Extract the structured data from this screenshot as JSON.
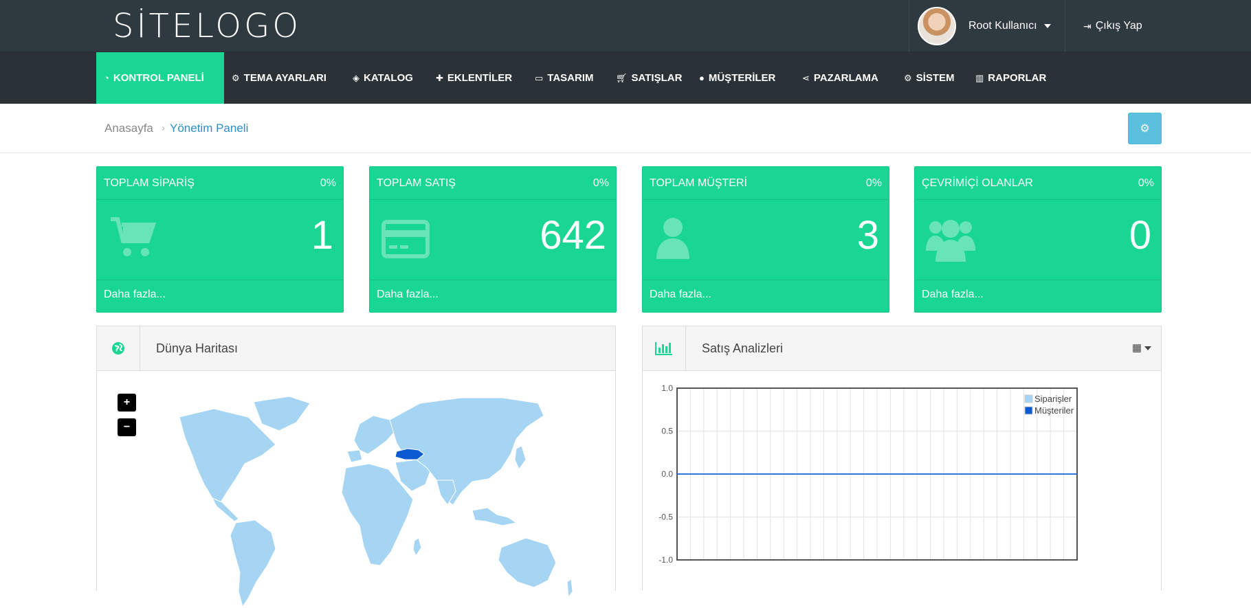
{
  "header": {
    "logo": "SİTELOGO",
    "user_name": "Root Kullanıcı",
    "logout_label": "Çıkış Yap"
  },
  "nav": {
    "items": [
      {
        "label": "KONTROL PANELİ",
        "icon": "dashboard-icon"
      },
      {
        "label": "TEMA AYARLARI",
        "icon": "cogs-icon"
      },
      {
        "label": "KATALOG",
        "icon": "tags-icon"
      },
      {
        "label": "EKLENTİLER",
        "icon": "puzzle-icon"
      },
      {
        "label": "TASARIM",
        "icon": "desktop-icon"
      },
      {
        "label": "SATIŞLAR",
        "icon": "cart-icon"
      },
      {
        "label": "MÜŞTERİLER",
        "icon": "user-icon"
      },
      {
        "label": "PAZARLAMA",
        "icon": "share-icon"
      },
      {
        "label": "SİSTEM",
        "icon": "gear-icon"
      },
      {
        "label": "RAPORLAR",
        "icon": "bar-chart-icon"
      }
    ]
  },
  "breadcrumb": {
    "home": "Anasayfa",
    "separator": "›",
    "current": "Yönetim Paneli"
  },
  "tiles": [
    {
      "title": "TOPLAM SİPARİŞ",
      "percent": "0%",
      "value": "1",
      "more": "Daha fazla...",
      "icon": "cart-icon"
    },
    {
      "title": "TOPLAM SATIŞ",
      "percent": "0%",
      "value": "642",
      "more": "Daha fazla...",
      "icon": "credit-card-icon"
    },
    {
      "title": "TOPLAM MÜŞTERİ",
      "percent": "0%",
      "value": "3",
      "more": "Daha fazla...",
      "icon": "user-icon"
    },
    {
      "title": "ÇEVRİMİÇİ OLANLAR",
      "percent": "0%",
      "value": "0",
      "more": "Daha fazla...",
      "icon": "users-icon"
    }
  ],
  "map_panel": {
    "title": "Dünya Haritası",
    "zoom_in": "+",
    "zoom_out": "−",
    "highlight_color": "#0a5bd1",
    "land_color": "#a5d5f2"
  },
  "chart_panel": {
    "title": "Satış Analizleri"
  },
  "colors": {
    "accent": "#19d693",
    "topbar": "#2f3940",
    "navbar": "#2a3238",
    "link": "#2a8fc8",
    "info_button": "#5bc0de"
  },
  "chart_data": {
    "type": "line",
    "series": [
      {
        "name": "Siparişler",
        "color": "#a5d5f2",
        "values": [
          0,
          0,
          0,
          0,
          0,
          0,
          0,
          0,
          0,
          0,
          0,
          0,
          0,
          0,
          0,
          0,
          0,
          0,
          0,
          0,
          0,
          0,
          0,
          0,
          0,
          0,
          0,
          0,
          0,
          0,
          0
        ]
      },
      {
        "name": "Müşteriler",
        "color": "#0a5bd1",
        "values": [
          0,
          0,
          0,
          0,
          0,
          0,
          0,
          0,
          0,
          0,
          0,
          0,
          0,
          0,
          0,
          0,
          0,
          0,
          0,
          0,
          0,
          0,
          0,
          0,
          0,
          0,
          0,
          0,
          0,
          0,
          0
        ]
      }
    ],
    "ylim": [
      -1.0,
      1.0
    ],
    "yticks": [
      "1.0",
      "0.5",
      "0.0",
      "-0.5",
      "-1.0"
    ],
    "grid": true,
    "legend": "top-right"
  }
}
